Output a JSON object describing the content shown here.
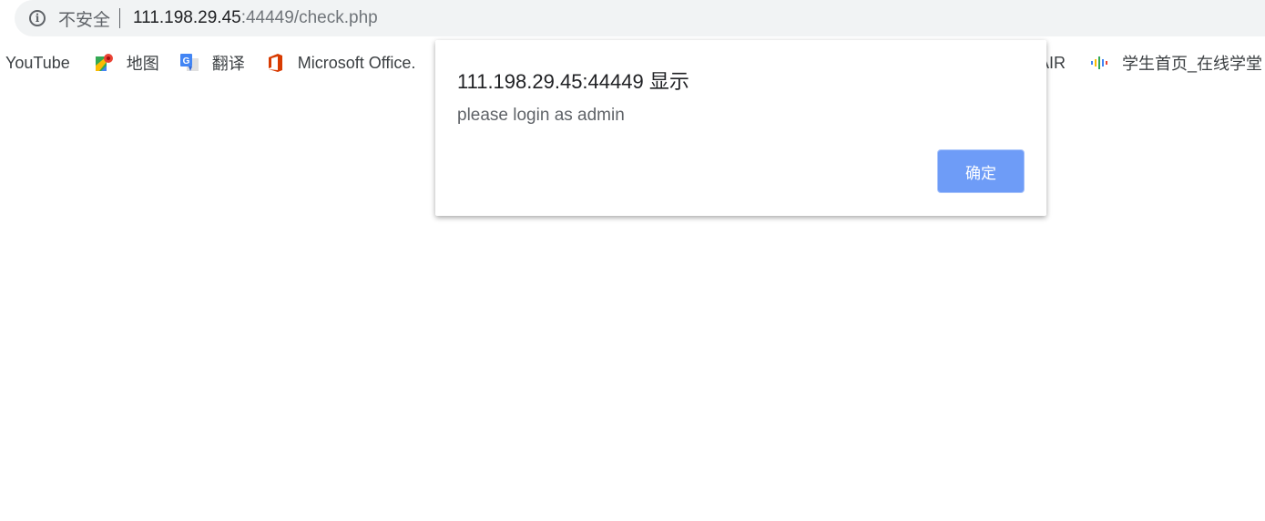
{
  "address_bar": {
    "security_label": "不安全",
    "host": "111.198.29.45",
    "rest": ":44449/check.php",
    "icon": "info-icon"
  },
  "bookmarks": [
    {
      "label": "YouTube",
      "icon": ""
    },
    {
      "label": "地图",
      "icon": "maps-icon"
    },
    {
      "label": "翻译",
      "icon": "translate-icon"
    },
    {
      "label": "Microsoft Office.",
      "icon": "office-icon"
    }
  ],
  "bookmarks_right": [
    {
      "label": "AIR"
    },
    {
      "label": "学生首页_在线学堂",
      "icon": "audio-bars-icon"
    }
  ],
  "dialog": {
    "title": "111.198.29.45:44449 显示",
    "message": "please login as admin",
    "ok_label": "确定",
    "accent": "#6e9cf7"
  }
}
